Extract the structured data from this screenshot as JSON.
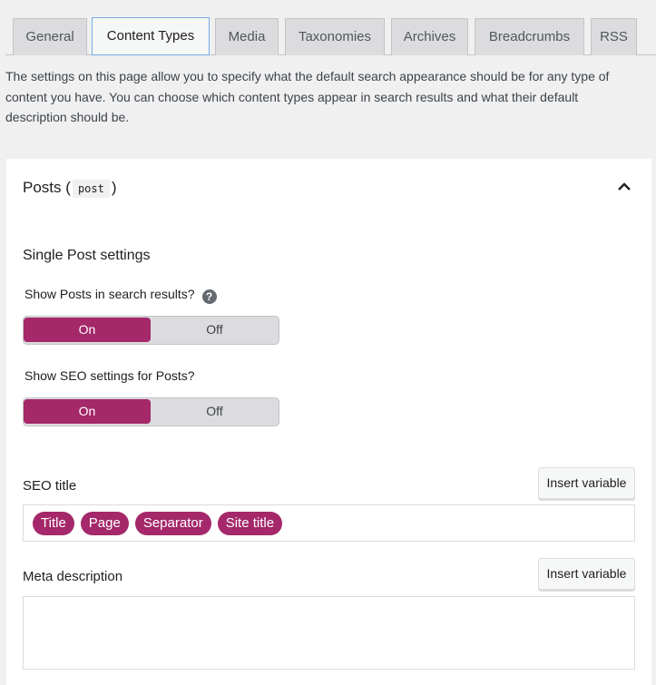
{
  "tabs": [
    {
      "label": "General",
      "active": false
    },
    {
      "label": "Content Types",
      "active": true
    },
    {
      "label": "Media",
      "active": false
    },
    {
      "label": "Taxonomies",
      "active": false
    },
    {
      "label": "Archives",
      "active": false
    },
    {
      "label": "Breadcrumbs",
      "active": false
    },
    {
      "label": "RSS",
      "active": false
    }
  ],
  "intro": "The settings on this page allow you to specify what the default search appearance should be for any type of content you have. You can choose which content types appear in search results and what their default description should be.",
  "panel": {
    "title": "Posts",
    "open_paren": "(",
    "slug": "post",
    "close_paren": ")",
    "collapse_icon": "chevron-up-icon",
    "section_heading": "Single Post settings",
    "show_in_search": {
      "label": "Show Posts in search results?",
      "help_icon": "?",
      "on_label": "On",
      "off_label": "Off",
      "value": "On"
    },
    "show_seo_settings": {
      "label": "Show SEO settings for Posts?",
      "on_label": "On",
      "off_label": "Off",
      "value": "On"
    },
    "seo_title": {
      "label": "SEO title",
      "insert_button": "Insert variable",
      "variables": [
        "Title",
        "Page",
        "Separator",
        "Site title"
      ]
    },
    "meta_description": {
      "label": "Meta description",
      "insert_button": "Insert variable",
      "value": ""
    }
  },
  "colors": {
    "accent": "#a4286a",
    "background": "#f0f0f1",
    "active_tab_border": "#72aee6"
  }
}
